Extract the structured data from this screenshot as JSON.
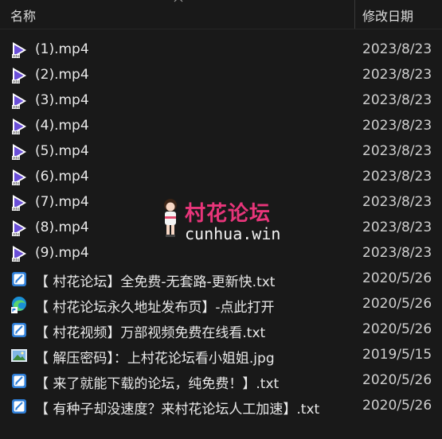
{
  "columns": {
    "name": "名称",
    "date": "修改日期"
  },
  "files": [
    {
      "name": "(1).mp4",
      "date": "2023/8/23 ",
      "icon": "mp4-video-icon"
    },
    {
      "name": "(2).mp4",
      "date": "2023/8/23 ",
      "icon": "mp4-video-icon"
    },
    {
      "name": "(3).mp4",
      "date": "2023/8/23 ",
      "icon": "mp4-video-icon"
    },
    {
      "name": "(4).mp4",
      "date": "2023/8/23 ",
      "icon": "mp4-video-icon"
    },
    {
      "name": "(5).mp4",
      "date": "2023/8/23 ",
      "icon": "mp4-video-icon"
    },
    {
      "name": "(6).mp4",
      "date": "2023/8/23 ",
      "icon": "mp4-video-icon"
    },
    {
      "name": "(7).mp4",
      "date": "2023/8/23 ",
      "icon": "mp4-video-icon"
    },
    {
      "name": "(8).mp4",
      "date": "2023/8/23 ",
      "icon": "mp4-video-icon"
    },
    {
      "name": "(9).mp4",
      "date": "2023/8/23 ",
      "icon": "mp4-video-icon"
    },
    {
      "name": "【 村花论坛】全免费-无套路-更新快.txt",
      "date": "2020/5/26 ",
      "icon": "text-file-icon"
    },
    {
      "name": "【 村花论坛永久地址发布页】-点此打开",
      "date": "2020/5/26 ",
      "icon": "edge-shortcut-icon"
    },
    {
      "name": "【 村花视频】万部视频免费在线看.txt",
      "date": "2020/5/26 ",
      "icon": "text-file-icon"
    },
    {
      "name": "【 解压密码】：上村花论坛看小姐姐.jpg",
      "date": "2019/5/15 ",
      "icon": "image-file-icon"
    },
    {
      "name": "【 来了就能下载的论坛，纯免费！】.txt",
      "date": "2020/5/26 ",
      "icon": "text-file-icon"
    },
    {
      "name": "【 有种子却没速度？来村花论坛人工加速】.txt",
      "date": "2020/5/26 ",
      "icon": "text-file-icon"
    }
  ],
  "watermark": {
    "title": "村花论坛",
    "url": "cunhua.win"
  },
  "colors": {
    "background": "#191919",
    "video_icon": "#6b4fd8",
    "watermark_title": "#e8357a"
  }
}
